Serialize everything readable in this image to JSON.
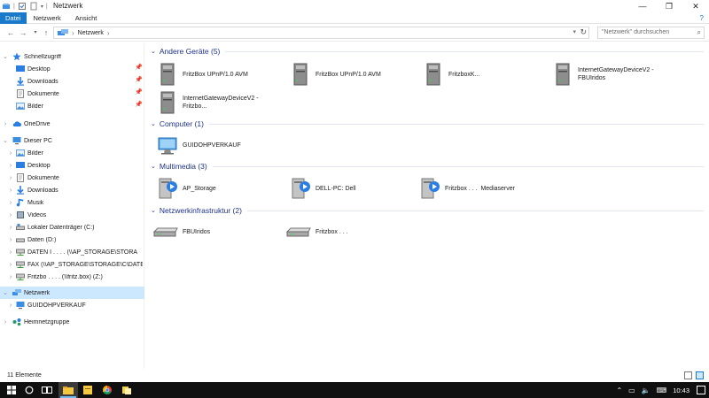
{
  "window": {
    "title": "Netzwerk"
  },
  "ribbon": {
    "tabs": [
      "Datei",
      "Netzwerk",
      "Ansicht"
    ]
  },
  "address": {
    "crumb": "Netzwerk",
    "search_placeholder": "\"Netzwerk\" durchsuchen"
  },
  "sidebar": {
    "quick_access": "Schnellzugriff",
    "quick_items": [
      "Desktop",
      "Downloads",
      "Dokumente",
      "Bilder"
    ],
    "onedrive": "OneDrive",
    "this_pc": "Dieser PC",
    "pc_items": [
      "Bilder",
      "Desktop",
      "Dokumente",
      "Downloads",
      "Musik",
      "Videos",
      "Lokaler Datenträger (C:)",
      "Daten (D:)",
      "DATEN I . . . . (\\\\AP_STORAGE\\STORA",
      "FAX (\\\\AP_STORAGE\\STORAGE\\C\\DATEN\\FAX",
      "Fritzbo . . . . (\\\\fritz.box) (Z:)"
    ],
    "network": "Netzwerk",
    "network_child": "GUIDOHPVERKAUF",
    "homegroup": "Heimnetzgruppe"
  },
  "groups": {
    "other_devices": "Andere Geräte (5)",
    "computer": "Computer (1)",
    "multimedia": "Multimedia (3)",
    "infrastructure": "Netzwerkinfrastruktur (2)"
  },
  "items": {
    "other_devices": [
      "FritzBox UPnP/1.0 AVM",
      "FritzBox UPnP/1.0 AVM",
      "FritzboxK...",
      "InternetGatewayDeviceV2 -\nFBUIridos",
      "InternetGatewayDeviceV2 -\nFritzbo..."
    ],
    "computer": [
      "GUIDOHPVERKAUF"
    ],
    "multimedia": [
      "AP_Storage",
      "DELL-PC: Dell",
      "Fritzbox . . .  Mediaserver"
    ],
    "infrastructure": [
      "FBUIridos",
      "Fritzbox . . ."
    ]
  },
  "status": {
    "count": "11 Elemente"
  },
  "taskbar": {
    "time": "10:43"
  },
  "icons": {
    "title": "network-folder-icon",
    "device": "server-tower-icon",
    "computer": "desktop-computer-icon",
    "media": "media-server-icon",
    "router": "router-icon"
  },
  "colors": {
    "accent": "#1979ca",
    "group_header": "#1e3287",
    "selection": "#cce8ff"
  }
}
